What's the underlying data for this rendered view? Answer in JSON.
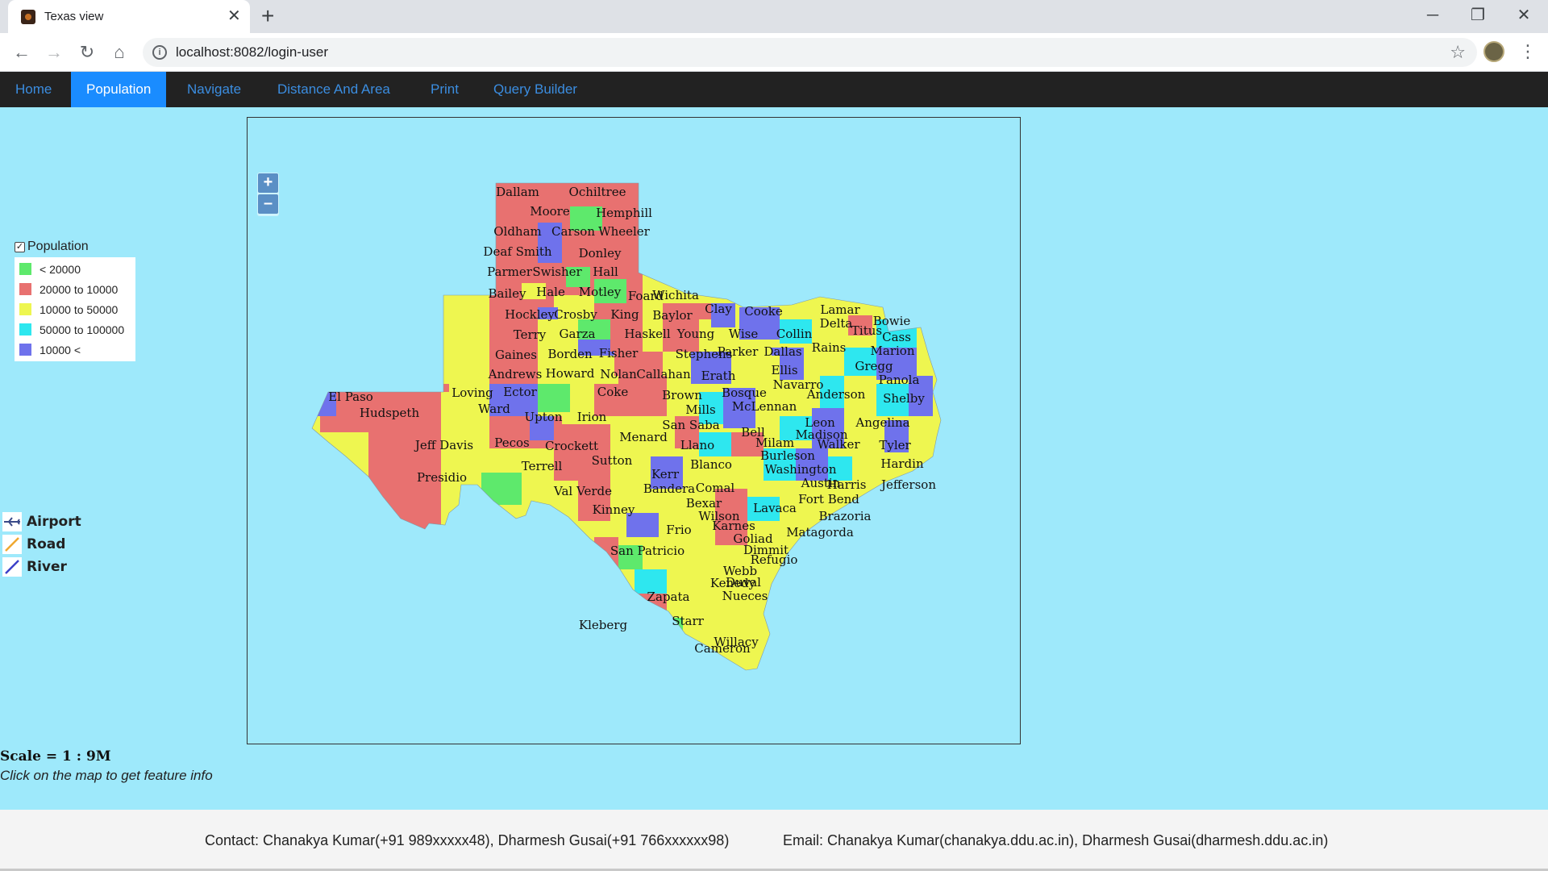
{
  "browser": {
    "tab_title": "Texas view",
    "url": "localhost:8082/login-user",
    "tab_close_glyph": "✕",
    "new_tab_glyph": "+"
  },
  "nav": {
    "items": [
      "Home",
      "Population",
      "Navigate",
      "Distance And Area",
      "Print",
      "Query Builder"
    ],
    "active": "Population"
  },
  "map": {
    "zoom_in": "+",
    "zoom_out": "–",
    "county_labels": [
      "Dallam",
      "Ochiltree",
      "Moore",
      "Hemphill",
      "Oldham",
      "Carson",
      "Wheeler",
      "Deaf Smith",
      "Donley",
      "Parmer",
      "Swisher",
      "Hall",
      "Bailey",
      "Hale",
      "Motley",
      "Foard",
      "Wichita",
      "Hockley",
      "Crosby",
      "King",
      "Clay",
      "Cooke",
      "Lamar",
      "Bowie",
      "Terry",
      "Garza",
      "Baylor",
      "Delta",
      "Titus",
      "Cass",
      "Gaines",
      "Borden",
      "Haskell",
      "Young",
      "Wise",
      "Collin",
      "Marion",
      "Andrews",
      "Howard",
      "Fisher",
      "Stephens",
      "Parker",
      "Dallas",
      "Rains",
      "Gregg",
      "Nolan",
      "Callahan",
      "Erath",
      "Ellis",
      "Navarro",
      "Panola",
      "El Paso",
      "Loving",
      "Ector",
      "Coke",
      "Brown",
      "Bosque",
      "Anderson",
      "Shelby",
      "Hudspeth",
      "Ward",
      "Upton",
      "Irion",
      "Mills",
      "McLennan",
      "Pecos",
      "San Saba",
      "Bell",
      "Leon",
      "Angelina",
      "Jeff Davis",
      "Crockett",
      "Menard",
      "Madison",
      "Milam",
      "Tyler",
      "Sutton",
      "Llano",
      "Walker",
      "Burleson",
      "Hardin",
      "Presidio",
      "Terrell",
      "Blanco",
      "Washington",
      "Austin",
      "Harris",
      "Jefferson",
      "Val Verde",
      "Kerr",
      "Comal",
      "Bandera",
      "Fort Bend",
      "Bexar",
      "Lavaca",
      "Brazoria",
      "Kinney",
      "Wilson",
      "Karnes",
      "Frio",
      "Matagorda",
      "Goliad",
      "Dimmit",
      "Refugio",
      "San Patricio",
      "Webb",
      "Duval",
      "Nueces",
      "Kleberg",
      "Zapata",
      "Kenedy",
      "Starr",
      "Willacy",
      "Cameron"
    ],
    "legend": {
      "title": "Population",
      "items": [
        {
          "label": "< 20000",
          "color": "#5ee96c"
        },
        {
          "label": "20000 to 10000",
          "color": "#e87170"
        },
        {
          "label": "10000 to 50000",
          "color": "#eef650"
        },
        {
          "label": "50000 to 100000",
          "color": "#2ee7ef"
        },
        {
          "label": "10000 <",
          "color": "#6f72ec"
        }
      ]
    },
    "layers": [
      {
        "label": "Airport",
        "icon": "airplane-icon"
      },
      {
        "label": "Road",
        "icon": "road-line-icon",
        "color": "#f0a830"
      },
      {
        "label": "River",
        "icon": "river-line-icon",
        "color": "#3b40c8"
      }
    ],
    "scale_text": "Scale = 1 : 9M",
    "hint": "Click on the map to get feature info"
  },
  "footer": {
    "contact": "Contact: Chanakya Kumar(+91 989xxxxx48), Dharmesh Gusai(+91 766xxxxxx98)",
    "email": "Email: Chanakya Kumar(chanakya.ddu.ac.in), Dharmesh Gusai(dharmesh.ddu.ac.in)"
  }
}
